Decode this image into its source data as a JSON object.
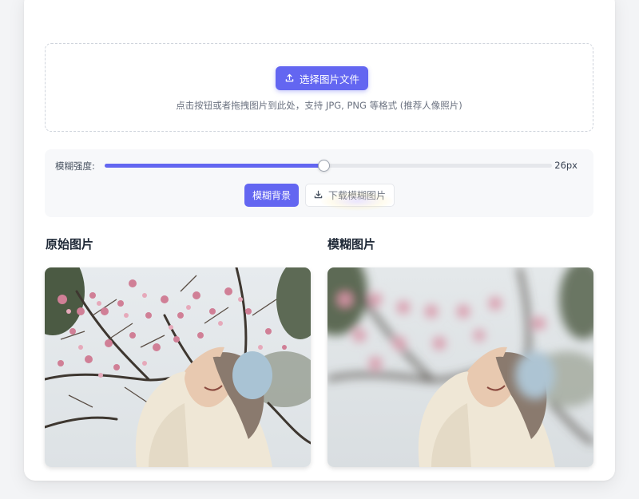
{
  "upload": {
    "button_label": "选择图片文件",
    "icon": "upload-icon",
    "hint": "点击按钮或者拖拽图片到此处，支持 JPG, PNG 等格式 (推荐人像照片)"
  },
  "controls": {
    "blur_label": "模糊强度:",
    "blur_value": "26px",
    "slider_level_percent": 49,
    "blur_button_label": "模糊背景",
    "download_button_label": "下载模糊图片",
    "download_icon": "download-icon"
  },
  "original": {
    "title": "原始图片"
  },
  "blurred": {
    "title": "模糊图片"
  },
  "colors": {
    "accent": "#6366f1",
    "background": "#f3f4f6",
    "card": "#ffffff",
    "control_panel": "#f7f8fa"
  }
}
